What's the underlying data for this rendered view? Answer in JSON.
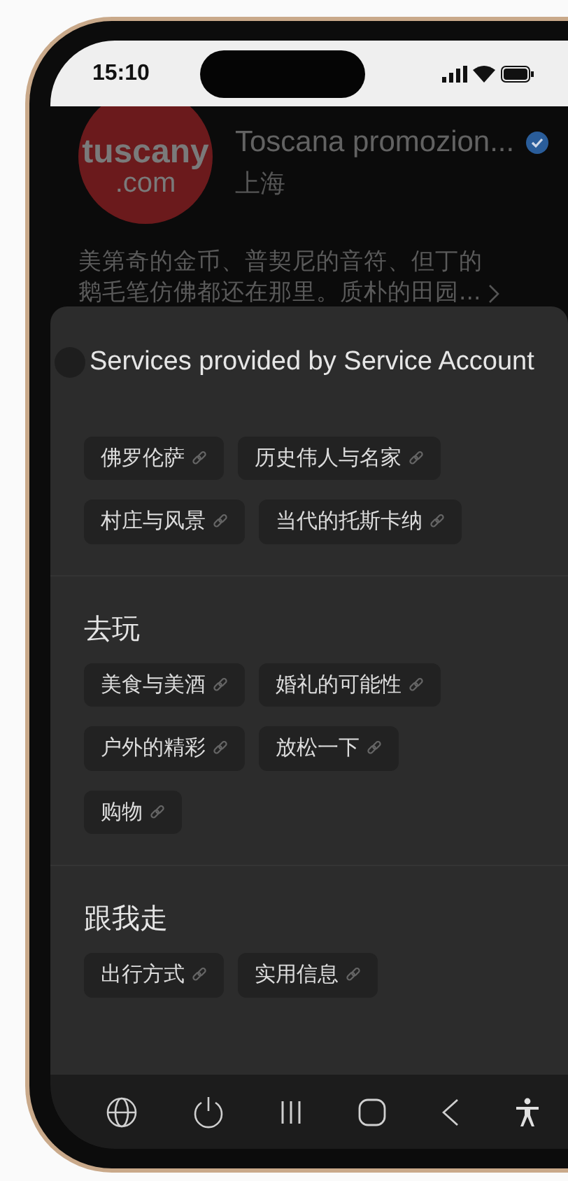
{
  "status_bar": {
    "time": "15:10"
  },
  "profile": {
    "logo_top": "tuscany",
    "logo_bottom": ".com",
    "name": "Toscana promozion...",
    "location": "上海",
    "description_lines": [
      "美第奇的金币、普契尼的音符、但丁的",
      "鹅毛笔仿佛都还在那里。质朴的田园..."
    ]
  },
  "sheet": {
    "title": "Services provided by Service Account",
    "sections": [
      {
        "links": [
          "佛罗伦萨",
          "历史伟人与名家",
          "村庄与风景",
          "当代的托斯卡纳"
        ]
      },
      {
        "heading": "去玩",
        "links": [
          "美食与美酒",
          "婚礼的可能性",
          "户外的精彩",
          "放松一下",
          "购物"
        ]
      },
      {
        "heading": "跟我走",
        "links": [
          "出行方式",
          "实用信息"
        ]
      }
    ]
  }
}
